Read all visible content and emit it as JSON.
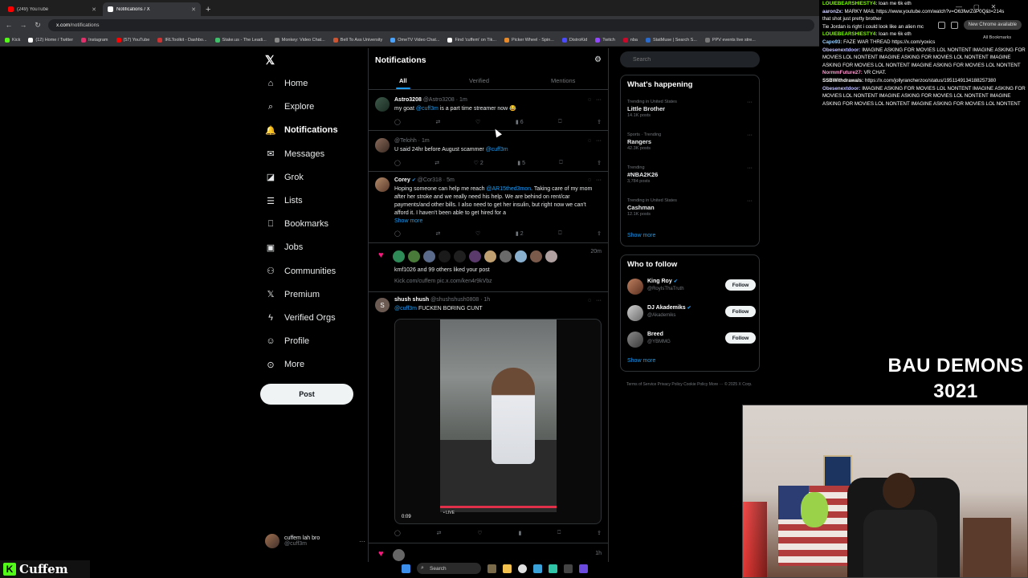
{
  "browser": {
    "tabs": [
      {
        "label": "(249) YouTube",
        "color": "#ff0000"
      },
      {
        "label": "(12) Home / Twitter",
        "color": "#ffffff"
      },
      {
        "label": "Notifications / X",
        "color": "#ffffff"
      }
    ],
    "url_host": "x.com",
    "url_path": "/notifications",
    "bookmarks": [
      "Kick",
      "(12) Home / Twitter",
      "Instagram",
      "(57) YouTube",
      "IRLToolkit - Dashbo...",
      "Stake.us - The Leadi...",
      "Monkey: Video Chat...",
      "Bell To Ass University",
      "OmeTV Video Chat...",
      "Find 'cuffem' on Tik...",
      "Picker Wheel - Spin...",
      "DistroKid",
      "Twitch",
      "nba",
      "StatMuse | Search S...",
      "PPV events live stre..."
    ],
    "new_chrome": "New Chrome available",
    "all_bookmarks": "All Bookmarks"
  },
  "nav": {
    "items": [
      {
        "label": "Home",
        "icon": "home-icon"
      },
      {
        "label": "Explore",
        "icon": "search-icon"
      },
      {
        "label": "Notifications",
        "icon": "bell-icon"
      },
      {
        "label": "Messages",
        "icon": "mail-icon"
      },
      {
        "label": "Grok",
        "icon": "grok-icon"
      },
      {
        "label": "Lists",
        "icon": "list-icon"
      },
      {
        "label": "Bookmarks",
        "icon": "bookmark-icon"
      },
      {
        "label": "Jobs",
        "icon": "briefcase-icon"
      },
      {
        "label": "Communities",
        "icon": "people-icon"
      },
      {
        "label": "Premium",
        "icon": "x-icon"
      },
      {
        "label": "Verified Orgs",
        "icon": "lightning-icon"
      },
      {
        "label": "Profile",
        "icon": "person-icon"
      },
      {
        "label": "More",
        "icon": "more-circle-icon"
      }
    ],
    "post_label": "Post",
    "account_name": "cuffem lah bro",
    "account_handle": "@cuff3m"
  },
  "center": {
    "title": "Notifications",
    "tabs": [
      "All",
      "Verified",
      "Mentions"
    ],
    "notifications": [
      {
        "name": "Astro3208",
        "handle": "@Astro3208 · 1m",
        "text_pre": "my goat ",
        "mention": "@cuff3m",
        "text_post": " is a part time streamer now 😂",
        "views": "6"
      },
      {
        "name": "",
        "handle": "@Telohh · 1m",
        "text_pre": "U said 24hr before August scammer ",
        "mention": "@cuff3m",
        "text_post": "",
        "likes": "2",
        "views": "5"
      },
      {
        "name": "Corey",
        "handle": "@Cor318 · 5m",
        "text_pre": "Hoping someone can help me reach ",
        "mention": "@AR15thed3mon",
        "text_post": ". Taking care of my mom after her stroke and we really need his help. We are behind on rent/car payments/and other bills. I also need to get her insulin, but right now we can't afford it. I haven't been able to get hired for a",
        "show_more": "Show more",
        "views": "2"
      },
      {
        "liked_by": "kmf1026 and 99 others liked your post",
        "link": "Kick.com/cuffem pic.x.com/ken4r9kVbz",
        "time": "20m"
      },
      {
        "name": "shush shush",
        "handle": "@shushshush0808 · 1h",
        "mention": "@cuff3m",
        "text_post": " FUCKEN BORING CUNT",
        "video_time": "0:09",
        "live_label": "• LIVE"
      },
      {
        "time": "1h"
      }
    ]
  },
  "right": {
    "search_placeholder": "Search",
    "happening_title": "What's happening",
    "trends": [
      {
        "context": "Trending in United States",
        "name": "Little Brother",
        "count": "14.1K posts"
      },
      {
        "context": "Sports · Trending",
        "name": "Rangers",
        "count": "42.3K posts"
      },
      {
        "context": "Trending",
        "name": "#NBA2K26",
        "count": "3,784 posts"
      },
      {
        "context": "Trending in United States",
        "name": "Cashman",
        "count": "12.1K posts"
      }
    ],
    "show_more": "Show more",
    "follow_title": "Who to follow",
    "follow": [
      {
        "name": "King Roy",
        "handle": "@RoyIsThaTruth",
        "button": "Follow",
        "verified": true
      },
      {
        "name": "DJ Akademiks",
        "handle": "@Akademiks",
        "button": "Follow",
        "verified": true
      },
      {
        "name": "Breed",
        "handle": "@YBMMG",
        "button": "Follow",
        "verified": false
      }
    ],
    "footer": "Terms of Service   Privacy Policy   Cookie Policy   More ···   © 2025 X Corp."
  },
  "chat": [
    {
      "user": "LOUIEBEARSHIESTY4:",
      "text": "loan me 6k eth"
    },
    {
      "user": "aaron2x:",
      "text": "MARKY MAIL https://www.youtube.com/watch?v=O63fwrZoP0Q&t=214s"
    },
    {
      "user": "",
      "text": "that shot just pretty brother"
    },
    {
      "user": "",
      "text": "Tie Jordan is right i could look like an alien mc"
    },
    {
      "user": "LOUIEBEARSHIESTY4:",
      "text": "loan me 6k eth"
    },
    {
      "user": "Capo93:",
      "text": "FAZE WAR THREAD https://x.com/yoxics"
    },
    {
      "user": "Obesenextdoor:",
      "text": "IMAGINE ASKING FOR MOVIES LOL NONTENT IMAGINE ASKING FOR MOVIES LOL NONTENT IMAGINE ASKING FOR MOVIES LOL NONTENT IMAGINE ASKING FOR MOVIES LOL NONTENT IMAGINE ASKING FOR MOVIES LOL NONTENT"
    },
    {
      "user": "NormmFuture27:",
      "text": "VR CHAT."
    },
    {
      "user": "SSBWithdrawals:",
      "text": "https://x.com/jollyrancherzoo/status/1951149134188257380"
    },
    {
      "user": "Obesenextdoor:",
      "text": "IMAGINE ASKING FOR MOVIES LOL NONTENT IMAGINE ASKING FOR MOVIES LOL NONTENT IMAGINE ASKING FOR MOVIES LOL NONTENT IMAGINE ASKING FOR MOVIES LOL NONTENT IMAGINE ASKING FOR MOVIES LOL NONTENT"
    }
  ],
  "stream": {
    "title_line1": "BAU DEMONS",
    "title_line2": "3021",
    "kick_name": "Cuffem"
  },
  "taskbar": {
    "search": "Search"
  }
}
